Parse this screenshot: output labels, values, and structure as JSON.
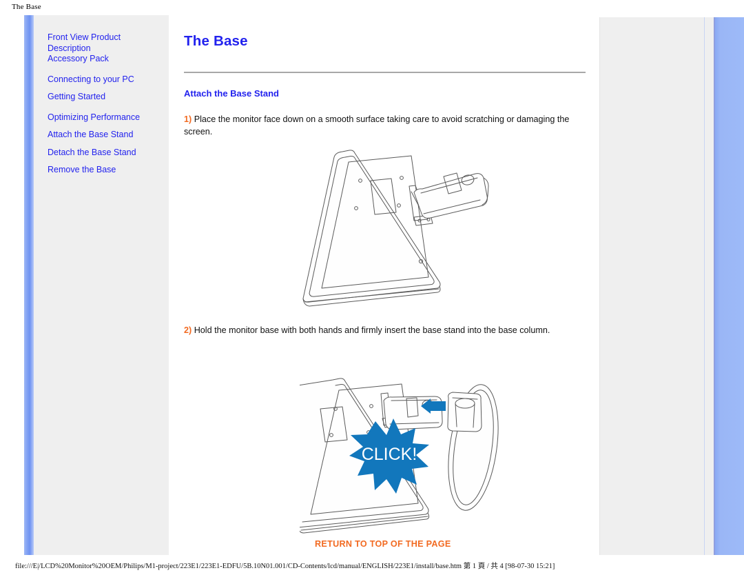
{
  "window": {
    "title": "The Base"
  },
  "sidebar": {
    "items": [
      {
        "label": "Front View Product Description",
        "name": "front-view-product-description"
      },
      {
        "label": "Accessory Pack",
        "name": "accessory-pack"
      },
      {
        "label": "Connecting to your PC",
        "name": "connecting-to-your-pc"
      },
      {
        "label": "Getting Started",
        "name": "getting-started"
      },
      {
        "label": "Optimizing Performance",
        "name": "optimizing-performance"
      },
      {
        "label": "Attach the Base Stand",
        "name": "attach-the-base-stand"
      },
      {
        "label": "Detach the Base Stand",
        "name": "detach-the-base-stand"
      },
      {
        "label": "Remove the Base",
        "name": "remove-the-base"
      }
    ]
  },
  "main": {
    "title": "The Base",
    "subhead": "Attach the Base Stand",
    "step1_num": "1)",
    "step1_text": " Place the monitor face down on a smooth surface taking care to avoid scratching or damaging the screen.",
    "step2_num": "2)",
    "step2_text": " Hold the monitor base with both hands and firmly insert the base stand into the base column.",
    "click_badge": "CLICK!",
    "return_top": "RETURN TO TOP OF THE PAGE"
  },
  "statusbar": {
    "path": "file:///E|/LCD%20Monitor%20OEM/Philips/M1-project/223E1/223E1-EDFU/5B.10N01.001/CD-Contents/lcd/manual/ENGLISH/223E1/install/base.htm 第 1 頁 / 共 4 [98-07-30 15:21]"
  },
  "colors": {
    "link_blue": "#2222ee",
    "accent_orange": "#f26a21",
    "badge_blue": "#1277bc",
    "stripe_blue": "#7fa0f3",
    "panel_gray": "#efefef"
  }
}
